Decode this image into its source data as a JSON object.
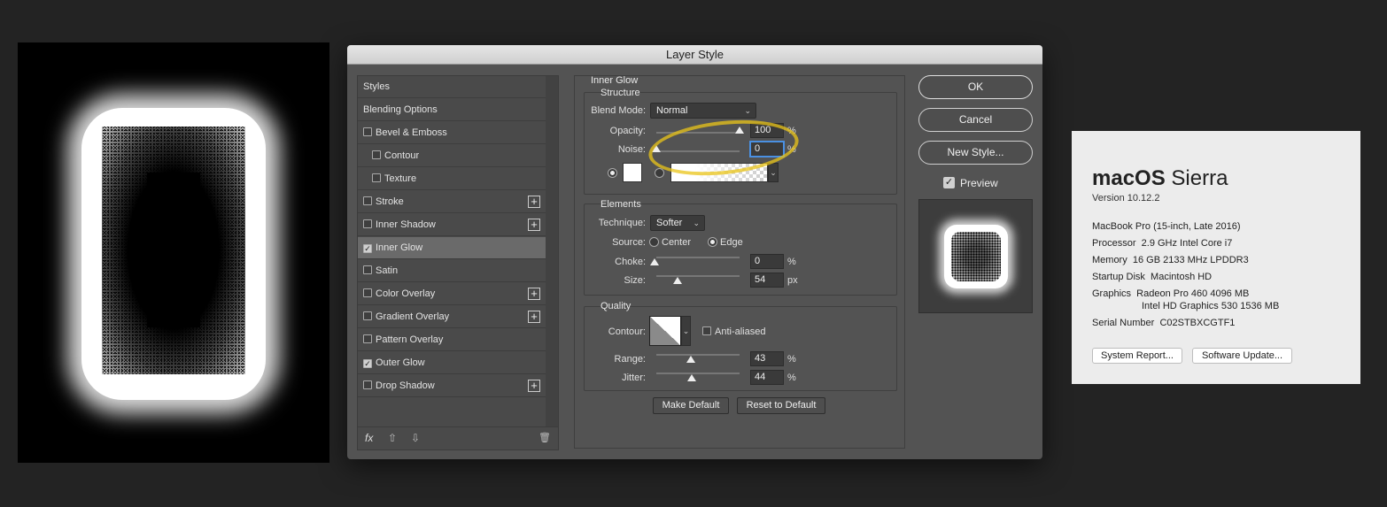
{
  "dialog": {
    "title": "Layer Style",
    "styles_header": "Styles",
    "items": [
      {
        "label": "Blending Options",
        "checkbox": false,
        "checked": false,
        "plus": false
      },
      {
        "label": "Bevel & Emboss",
        "checkbox": true,
        "checked": false,
        "plus": false
      },
      {
        "label": "Contour",
        "checkbox": true,
        "checked": false,
        "plus": false
      },
      {
        "label": "Texture",
        "checkbox": true,
        "checked": false,
        "plus": false
      },
      {
        "label": "Stroke",
        "checkbox": true,
        "checked": false,
        "plus": true
      },
      {
        "label": "Inner Shadow",
        "checkbox": true,
        "checked": false,
        "plus": true
      },
      {
        "label": "Inner Glow",
        "checkbox": true,
        "checked": true,
        "plus": false
      },
      {
        "label": "Satin",
        "checkbox": true,
        "checked": false,
        "plus": false
      },
      {
        "label": "Color Overlay",
        "checkbox": true,
        "checked": false,
        "plus": true
      },
      {
        "label": "Gradient Overlay",
        "checkbox": true,
        "checked": false,
        "plus": true
      },
      {
        "label": "Pattern Overlay",
        "checkbox": true,
        "checked": false,
        "plus": false
      },
      {
        "label": "Outer Glow",
        "checkbox": true,
        "checked": true,
        "plus": false
      },
      {
        "label": "Drop Shadow",
        "checkbox": true,
        "checked": false,
        "plus": true
      }
    ],
    "footer": {
      "fx": "fx",
      "up": "⇧",
      "down": "⇩",
      "trash": "🗑"
    },
    "inner_glow": {
      "title": "Inner Glow",
      "structure": "Structure",
      "blend_mode_label": "Blend Mode:",
      "blend_mode": "Normal",
      "opacity_label": "Opacity:",
      "opacity": "100",
      "noise_label": "Noise:",
      "noise": "0",
      "percent": "%",
      "elements": "Elements",
      "technique_label": "Technique:",
      "technique": "Softer",
      "source_label": "Source:",
      "source_center": "Center",
      "source_edge": "Edge",
      "choke_label": "Choke:",
      "choke": "0",
      "size_label": "Size:",
      "size": "54",
      "px": "px",
      "quality": "Quality",
      "contour_label": "Contour:",
      "anti_aliased": "Anti-aliased",
      "range_label": "Range:",
      "range": "43",
      "jitter_label": "Jitter:",
      "jitter": "44",
      "make_default": "Make Default",
      "reset_default": "Reset to Default"
    },
    "buttons": {
      "ok": "OK",
      "cancel": "Cancel",
      "new_style": "New Style..."
    },
    "preview_label": "Preview",
    "accent_highlight": "#eac418"
  },
  "about": {
    "os_bold": "macOS",
    "os_name": "Sierra",
    "version": "Version 10.12.2",
    "model": "MacBook Pro (15-inch, Late 2016)",
    "processor_label": "Processor",
    "processor": "2.9 GHz Intel Core i7",
    "memory_label": "Memory",
    "memory": "16 GB 2133 MHz LPDDR3",
    "disk_label": "Startup Disk",
    "disk": "Macintosh HD",
    "graphics_label": "Graphics",
    "graphics_1": "Radeon Pro 460 4096 MB",
    "graphics_2": "Intel HD Graphics 530 1536 MB",
    "serial_label": "Serial Number",
    "serial": "C02STBXCGTF1",
    "system_report": "System Report...",
    "software_update": "Software Update..."
  }
}
